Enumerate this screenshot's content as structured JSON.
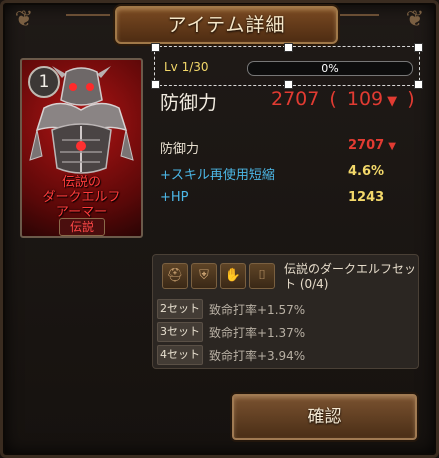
{
  "window": {
    "title": "アイテム詳細"
  },
  "item": {
    "quantity": "1",
    "name_lines": [
      "伝説の",
      "ダークエルフ",
      "アーマー"
    ],
    "rarity": "伝説"
  },
  "level": {
    "label": "Lv 1/30",
    "progress_text": "0%",
    "progress": 0
  },
  "main_stat": {
    "label": "防御力",
    "value": "2707",
    "paren_open": "(",
    "delta": "109",
    "arrow": "▼",
    "paren_close": ")"
  },
  "stats": [
    {
      "label": "防御力",
      "value": "2707",
      "arrow": "▼",
      "label_color": "#e8e0d0",
      "value_color": "#e23b32"
    },
    {
      "label": "+スキル再使用短縮",
      "value": "4.6%",
      "arrow": "",
      "label_color": "#4cb7e6",
      "value_color": "#f3d86a"
    },
    {
      "label": "+HP",
      "value": "1243",
      "arrow": "",
      "label_color": "#4cb7e6",
      "value_color": "#f3d86a"
    }
  ],
  "set_bonus": {
    "title": "伝説のダークエルフセット (0/4)",
    "icons": [
      "helmet-icon",
      "armor-icon",
      "gloves-icon",
      "boots-icon"
    ],
    "rows": [
      {
        "tag": "2セット",
        "effect": "致命打率+1.57%"
      },
      {
        "tag": "3セット",
        "effect": "致命打率+1.37%"
      },
      {
        "tag": "4セット",
        "effect": "致命打率+3.94%"
      }
    ]
  },
  "buttons": {
    "confirm": "確認"
  }
}
